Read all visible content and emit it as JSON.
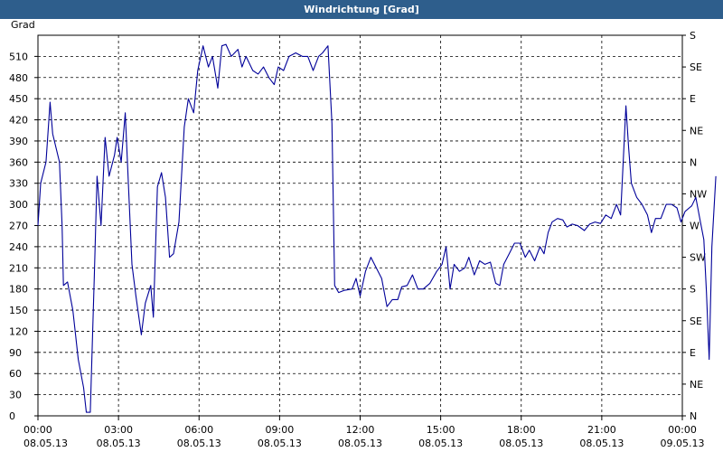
{
  "window": {
    "title": "Windrichtung [Grad]"
  },
  "chart_data": {
    "type": "line",
    "title": "Windrichtung [Grad]",
    "ylabel": "Grad",
    "ylim": [
      0,
      540
    ],
    "y_ticks": [
      0,
      30,
      60,
      90,
      120,
      150,
      180,
      210,
      240,
      270,
      300,
      330,
      360,
      390,
      420,
      450,
      480,
      510
    ],
    "right_ticks": [
      {
        "value": 0,
        "label": "N"
      },
      {
        "value": 45,
        "label": "NE"
      },
      {
        "value": 90,
        "label": "E"
      },
      {
        "value": 135,
        "label": "SE"
      },
      {
        "value": 180,
        "label": "S"
      },
      {
        "value": 225,
        "label": "SW"
      },
      {
        "value": 270,
        "label": "W"
      },
      {
        "value": 315,
        "label": "NW"
      },
      {
        "value": 360,
        "label": "N"
      },
      {
        "value": 405,
        "label": "NE"
      },
      {
        "value": 450,
        "label": "E"
      },
      {
        "value": 495,
        "label": "SE"
      },
      {
        "value": 540,
        "label": "S"
      }
    ],
    "x_range_hours": [
      0,
      24
    ],
    "x_ticks": [
      {
        "h": 0,
        "time": "00:00",
        "date": "08.05.13"
      },
      {
        "h": 3,
        "time": "03:00",
        "date": "08.05.13"
      },
      {
        "h": 6,
        "time": "06:00",
        "date": "08.05.13"
      },
      {
        "h": 9,
        "time": "09:00",
        "date": "08.05.13"
      },
      {
        "h": 12,
        "time": "12:00",
        "date": "08.05.13"
      },
      {
        "h": 15,
        "time": "15:00",
        "date": "08.05.13"
      },
      {
        "h": 18,
        "time": "18:00",
        "date": "08.05.13"
      },
      {
        "h": 21,
        "time": "21:00",
        "date": "08.05.13"
      },
      {
        "h": 24,
        "time": "00:00",
        "date": "09.05.13"
      }
    ],
    "grid": true,
    "series": [
      {
        "color": "#000099",
        "points": [
          [
            0.0,
            270
          ],
          [
            0.1,
            330
          ],
          [
            0.3,
            360
          ],
          [
            0.45,
            445
          ],
          [
            0.55,
            400
          ],
          [
            0.8,
            360
          ],
          [
            0.9,
            270
          ],
          [
            0.95,
            185
          ],
          [
            1.1,
            190
          ],
          [
            1.3,
            150
          ],
          [
            1.5,
            80
          ],
          [
            1.7,
            40
          ],
          [
            1.8,
            5
          ],
          [
            1.95,
            5
          ],
          [
            2.1,
            200
          ],
          [
            2.2,
            340
          ],
          [
            2.35,
            270
          ],
          [
            2.5,
            395
          ],
          [
            2.65,
            340
          ],
          [
            2.85,
            370
          ],
          [
            2.95,
            395
          ],
          [
            3.1,
            360
          ],
          [
            3.25,
            430
          ],
          [
            3.5,
            215
          ],
          [
            3.65,
            170
          ],
          [
            3.85,
            115
          ],
          [
            4.0,
            160
          ],
          [
            4.2,
            185
          ],
          [
            4.3,
            140
          ],
          [
            4.45,
            325
          ],
          [
            4.6,
            345
          ],
          [
            4.75,
            310
          ],
          [
            4.9,
            225
          ],
          [
            5.05,
            230
          ],
          [
            5.25,
            275
          ],
          [
            5.45,
            410
          ],
          [
            5.6,
            450
          ],
          [
            5.8,
            430
          ],
          [
            5.95,
            490
          ],
          [
            6.15,
            525
          ],
          [
            6.35,
            495
          ],
          [
            6.5,
            510
          ],
          [
            6.7,
            465
          ],
          [
            6.85,
            525
          ],
          [
            7.0,
            527
          ],
          [
            7.2,
            510
          ],
          [
            7.45,
            520
          ],
          [
            7.6,
            495
          ],
          [
            7.75,
            510
          ],
          [
            8.0,
            490
          ],
          [
            8.2,
            485
          ],
          [
            8.4,
            495
          ],
          [
            8.6,
            480
          ],
          [
            8.8,
            470
          ],
          [
            8.95,
            495
          ],
          [
            9.15,
            490
          ],
          [
            9.35,
            510
          ],
          [
            9.6,
            515
          ],
          [
            9.85,
            510
          ],
          [
            10.05,
            510
          ],
          [
            10.25,
            490
          ],
          [
            10.45,
            510
          ],
          [
            10.6,
            515
          ],
          [
            10.8,
            525
          ],
          [
            10.95,
            415
          ],
          [
            11.05,
            185
          ],
          [
            11.2,
            175
          ],
          [
            11.4,
            178
          ],
          [
            11.7,
            180
          ],
          [
            11.85,
            195
          ],
          [
            12.0,
            170
          ],
          [
            12.2,
            205
          ],
          [
            12.4,
            225
          ],
          [
            12.6,
            210
          ],
          [
            12.8,
            195
          ],
          [
            13.0,
            155
          ],
          [
            13.2,
            165
          ],
          [
            13.4,
            165
          ],
          [
            13.55,
            183
          ],
          [
            13.75,
            185
          ],
          [
            13.95,
            200
          ],
          [
            14.15,
            180
          ],
          [
            14.35,
            180
          ],
          [
            14.6,
            188
          ],
          [
            14.85,
            205
          ],
          [
            15.05,
            215
          ],
          [
            15.2,
            240
          ],
          [
            15.35,
            180
          ],
          [
            15.5,
            215
          ],
          [
            15.7,
            205
          ],
          [
            15.9,
            210
          ],
          [
            16.05,
            225
          ],
          [
            16.25,
            200
          ],
          [
            16.45,
            220
          ],
          [
            16.65,
            215
          ],
          [
            16.85,
            218
          ],
          [
            17.05,
            188
          ],
          [
            17.2,
            185
          ],
          [
            17.35,
            215
          ],
          [
            17.55,
            230
          ],
          [
            17.75,
            245
          ],
          [
            17.95,
            245
          ],
          [
            18.15,
            225
          ],
          [
            18.3,
            235
          ],
          [
            18.5,
            220
          ],
          [
            18.7,
            240
          ],
          [
            18.85,
            230
          ],
          [
            19.0,
            260
          ],
          [
            19.15,
            275
          ],
          [
            19.35,
            280
          ],
          [
            19.55,
            278
          ],
          [
            19.7,
            268
          ],
          [
            19.9,
            272
          ],
          [
            20.1,
            270
          ],
          [
            20.35,
            263
          ],
          [
            20.55,
            272
          ],
          [
            20.75,
            275
          ],
          [
            20.95,
            273
          ],
          [
            21.15,
            285
          ],
          [
            21.35,
            280
          ],
          [
            21.55,
            300
          ],
          [
            21.7,
            285
          ],
          [
            21.9,
            440
          ],
          [
            22.0,
            380
          ],
          [
            22.1,
            330
          ],
          [
            22.3,
            310
          ],
          [
            22.5,
            300
          ],
          [
            22.7,
            285
          ],
          [
            22.85,
            260
          ],
          [
            23.0,
            280
          ],
          [
            23.2,
            280
          ],
          [
            23.4,
            300
          ],
          [
            23.6,
            300
          ],
          [
            23.8,
            295
          ],
          [
            23.95,
            275
          ],
          [
            24.1,
            290
          ],
          [
            24.35,
            298
          ],
          [
            24.5,
            310
          ],
          [
            24.65,
            280
          ],
          [
            24.8,
            250
          ],
          [
            24.9,
            175
          ],
          [
            25.0,
            80
          ],
          [
            25.1,
            240
          ],
          [
            25.25,
            340
          ]
        ]
      }
    ]
  }
}
